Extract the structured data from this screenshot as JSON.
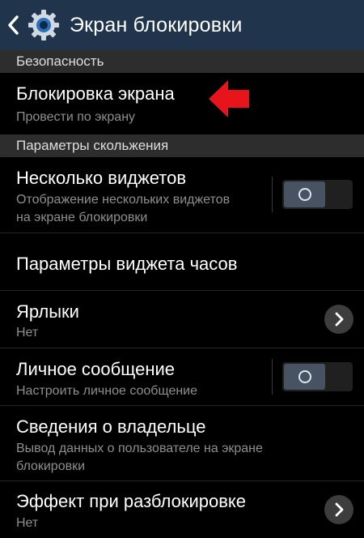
{
  "header": {
    "title": "Экран блокировки",
    "back_icon": "chevron-left-icon",
    "app_icon": "gear-icon"
  },
  "sections": [
    {
      "label": "Безопасность"
    },
    {
      "label": "Параметры скольжения"
    }
  ],
  "items": [
    {
      "title": "Блокировка экрана",
      "subtitle": "Провести по экрану"
    },
    {
      "title": "Несколько виджетов",
      "subtitle_line1": "Отображение нескольких виджетов",
      "subtitle_line2": "на экране блокировки",
      "toggle": "off"
    },
    {
      "title": "Параметры виджета часов"
    },
    {
      "title": "Ярлыки",
      "subtitle": "Нет",
      "action_icon": "chevron-right-icon"
    },
    {
      "title": "Личное сообщение",
      "subtitle": "Настроить личное сообщение",
      "toggle": "off"
    },
    {
      "title": "Сведения о владельце",
      "subtitle_line1": "Вывод данных о пользователе на экране",
      "subtitle_line2": "блокировки"
    },
    {
      "title": "Эффект при разблокировке",
      "subtitle": "Нет",
      "action_icon": "chevron-right-icon"
    }
  ],
  "annotation": {
    "icon": "red-arrow-icon",
    "color": "#e8141c"
  },
  "colors": {
    "action_bar": "#20354b",
    "section_header": "#2d2d2d",
    "subtitle": "#8f8f8f"
  }
}
